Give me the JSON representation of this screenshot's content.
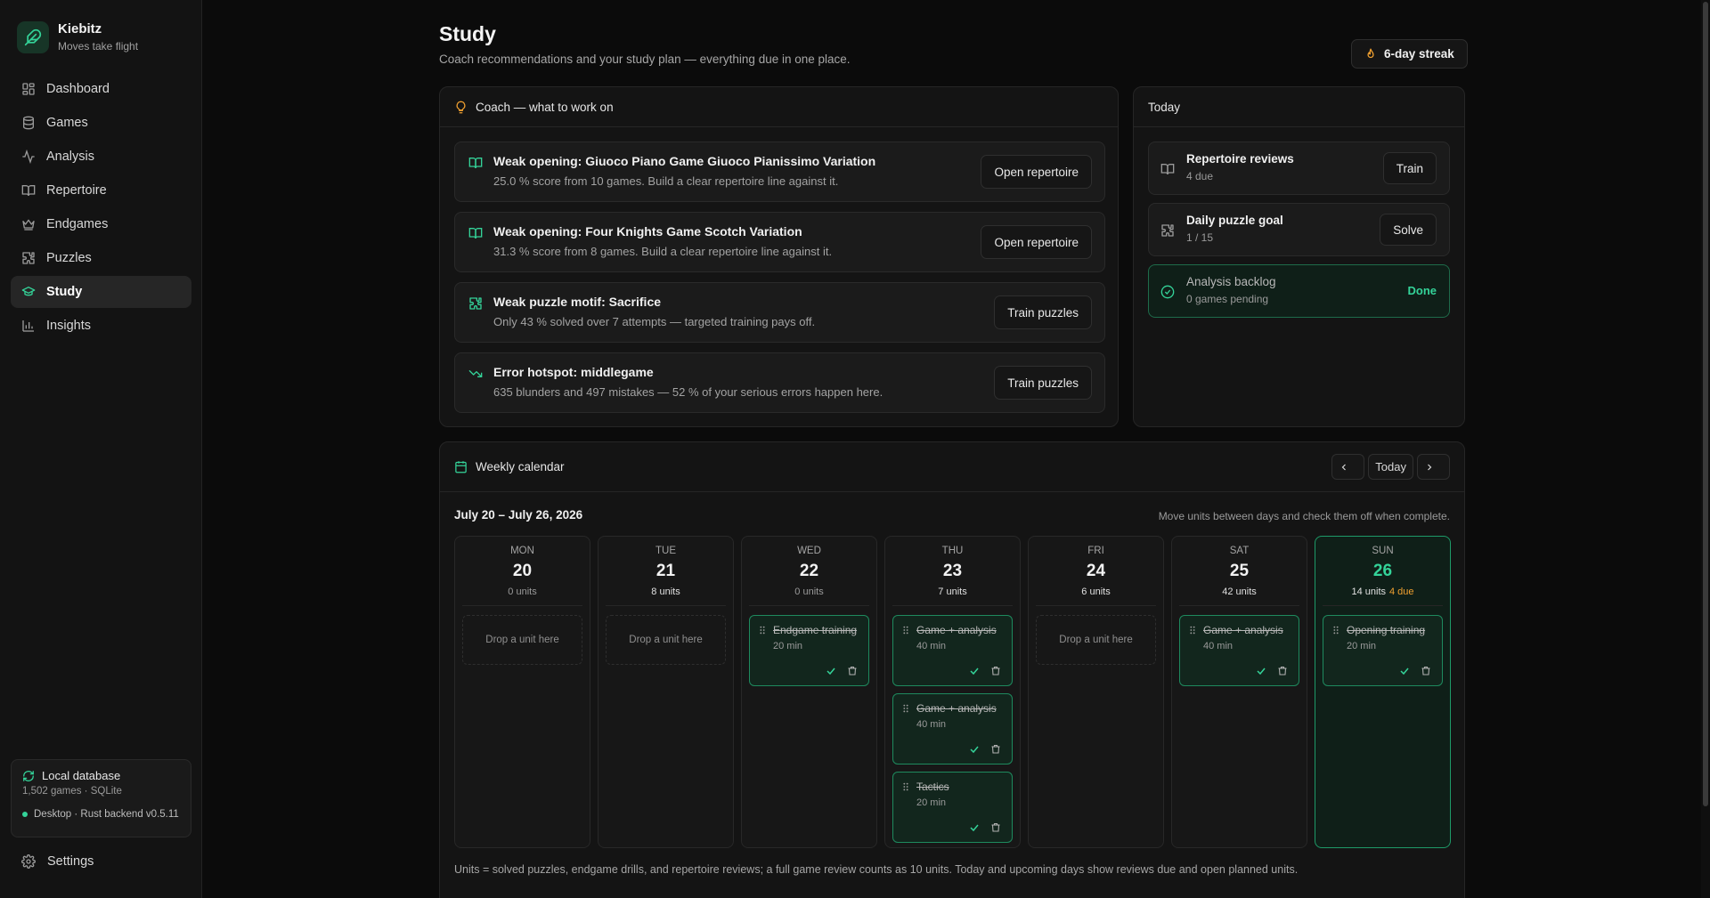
{
  "app": {
    "name": "Kiebitz",
    "tagline": "Moves take flight"
  },
  "sidebar": {
    "items": [
      {
        "label": "Dashboard",
        "icon": "dashboard-icon",
        "active": false
      },
      {
        "label": "Games",
        "icon": "database-icon",
        "active": false
      },
      {
        "label": "Analysis",
        "icon": "activity-icon",
        "active": false
      },
      {
        "label": "Repertoire",
        "icon": "book-icon",
        "active": false
      },
      {
        "label": "Endgames",
        "icon": "crown-icon",
        "active": false
      },
      {
        "label": "Puzzles",
        "icon": "puzzle-icon",
        "active": false
      },
      {
        "label": "Study",
        "icon": "graduation-cap-icon",
        "active": true
      },
      {
        "label": "Insights",
        "icon": "bar-chart-icon",
        "active": false
      }
    ],
    "db": {
      "title": "Local database",
      "sub": "1,502 games · SQLite",
      "status": "Desktop · Rust backend v0.5.11"
    },
    "settings": "Settings"
  },
  "header": {
    "title": "Study",
    "subtitle": "Coach recommendations and your study plan — everything due in one place.",
    "streak": "6-day streak"
  },
  "coach": {
    "title": "Coach — what to work on",
    "recs": [
      {
        "title": "Weak opening: Giuoco Piano Game Giuoco Pianissimo Variation",
        "desc": "25.0 % score from 10 games. Build a clear repertoire line against it.",
        "button": "Open repertoire",
        "icon": "book-open-icon"
      },
      {
        "title": "Weak opening: Four Knights Game Scotch Variation",
        "desc": "31.3 % score from 8 games. Build a clear repertoire line against it.",
        "button": "Open repertoire",
        "icon": "book-open-icon"
      },
      {
        "title": "Weak puzzle motif: Sacrifice",
        "desc": "Only 43 % solved over 7 attempts — targeted training pays off.",
        "button": "Train puzzles",
        "icon": "puzzle-icon"
      },
      {
        "title": "Error hotspot: middlegame",
        "desc": "635 blunders and 497 mistakes — 52 % of your serious errors happen here.",
        "button": "Train puzzles",
        "icon": "trending-down-icon"
      }
    ]
  },
  "today": {
    "title": "Today",
    "tasks": [
      {
        "title": "Repertoire reviews",
        "sub": "4 due",
        "button": "Train",
        "icon": "book-icon"
      },
      {
        "title": "Daily puzzle goal",
        "sub": "1 / 15",
        "button": "Solve",
        "icon": "puzzle-icon"
      },
      {
        "title": "Analysis backlog",
        "sub": "0 games pending",
        "status": "Done",
        "icon": "check-circle-icon"
      }
    ]
  },
  "calendar": {
    "title": "Weekly calendar",
    "today_btn": "Today",
    "range": "July 20 – July 26, 2026",
    "hint": "Move units between days and check them off when complete.",
    "drop_text": "Drop a unit here",
    "footer": "Units = solved puzzles, endgame drills, and repertoire reviews; a full game review counts as 10 units. Today and upcoming days show reviews due and open planned units.",
    "days": [
      {
        "name": "MON",
        "num": "20",
        "units": "0 units",
        "due": "",
        "items": []
      },
      {
        "name": "TUE",
        "num": "21",
        "units": "8 units",
        "due": "",
        "items": []
      },
      {
        "name": "WED",
        "num": "22",
        "units": "0 units",
        "due": "",
        "items": [
          {
            "name": "Endgame training",
            "dur": "20 min"
          }
        ]
      },
      {
        "name": "THU",
        "num": "23",
        "units": "7 units",
        "due": "",
        "items": [
          {
            "name": "Game + analysis",
            "dur": "40 min"
          },
          {
            "name": "Game + analysis",
            "dur": "40 min"
          },
          {
            "name": "Tactics",
            "dur": "20 min"
          }
        ]
      },
      {
        "name": "FRI",
        "num": "24",
        "units": "6 units",
        "due": "",
        "items": []
      },
      {
        "name": "SAT",
        "num": "25",
        "units": "42 units",
        "due": "",
        "items": [
          {
            "name": "Game + analysis",
            "dur": "40 min"
          }
        ]
      },
      {
        "name": "SUN",
        "num": "26",
        "units": "14 units",
        "due": "4 due",
        "items": [
          {
            "name": "Opening training",
            "dur": "20 min"
          }
        ],
        "today": true
      }
    ]
  },
  "colors": {
    "accent": "#34d399",
    "due": "#f0a030",
    "background": "#0b0b0b"
  }
}
